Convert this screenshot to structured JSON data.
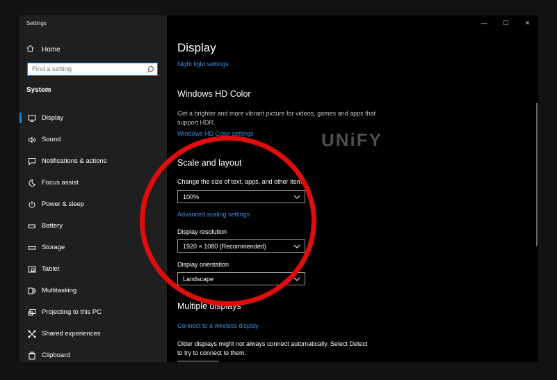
{
  "window": {
    "title": "Settings",
    "controls": [
      "—",
      "☐",
      "✕"
    ]
  },
  "sidebar": {
    "home_label": "Home",
    "search_placeholder": "Find a setting",
    "section_label": "System",
    "items": [
      {
        "label": "Display",
        "icon": "monitor-icon",
        "active": true
      },
      {
        "label": "Sound",
        "icon": "speaker-icon"
      },
      {
        "label": "Notifications & actions",
        "icon": "notification-icon"
      },
      {
        "label": "Focus assist",
        "icon": "moon-icon"
      },
      {
        "label": "Power & sleep",
        "icon": "power-icon"
      },
      {
        "label": "Battery",
        "icon": "battery-icon"
      },
      {
        "label": "Storage",
        "icon": "storage-icon"
      },
      {
        "label": "Tablet",
        "icon": "tablet-icon"
      },
      {
        "label": "Multitasking",
        "icon": "multitasking-icon"
      },
      {
        "label": "Projecting to this PC",
        "icon": "projector-icon"
      },
      {
        "label": "Shared experiences",
        "icon": "shared-icon"
      },
      {
        "label": "Clipboard",
        "icon": "clipboard-icon"
      }
    ]
  },
  "main": {
    "title": "Display",
    "night_light_link": "Night light settings",
    "hd_color": {
      "heading": "Windows HD Color",
      "description": "Get a brighter and more vibrant picture for videos, games and apps that support HDR.",
      "link": "Windows HD Color settings"
    },
    "scale_layout": {
      "heading": "Scale and layout",
      "scale_label": "Change the size of text, apps, and other items",
      "scale_value": "100%",
      "advanced_link": "Advanced scaling settings",
      "resolution_label": "Display resolution",
      "resolution_value": "1920 × 1080 (Recommended)",
      "orientation_label": "Display orientation",
      "orientation_value": "Landscape"
    },
    "multiple_displays": {
      "heading": "Multiple displays",
      "wireless_link": "Connect to a wireless display",
      "description": "Older displays might not always connect automatically. Select Detect to try to connect to them."
    }
  },
  "watermark": "UNiFY",
  "colors": {
    "accent": "#1b83d6",
    "link": "#3a8fe0",
    "annotation_circle": "#e10d0d",
    "sidebar_bg": "#1f1f1f",
    "content_bg": "#000000"
  }
}
